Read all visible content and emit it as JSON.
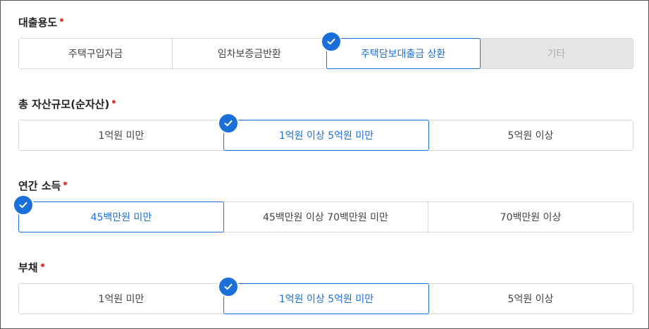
{
  "groups": [
    {
      "label": "대출용도",
      "required": true,
      "options": [
        "주택구입자금",
        "임차보증금반환",
        "주택담보대출금 상환",
        "기타"
      ],
      "selected": "주택담보대출금 상환",
      "disabled": [
        "기타"
      ]
    },
    {
      "label": "총 자산규모(순자산)",
      "required": true,
      "options": [
        "1억원 미만",
        "1억원 이상 5억원 미만",
        "5억원 이상"
      ],
      "selected": "1억원 이상 5억원 미만",
      "disabled": []
    },
    {
      "label": "연간 소득",
      "required": true,
      "options": [
        "45백만원 미만",
        "45백만원 이상 70백만원 미만",
        "70백만원 이상"
      ],
      "selected": "45백만원 미만",
      "disabled": []
    },
    {
      "label": "부채",
      "required": true,
      "options": [
        "1억원 미만",
        "1억원 이상 5억원 미만",
        "5억원 이상"
      ],
      "selected": "1억원 이상 5억원 미만",
      "disabled": []
    }
  ],
  "colors": {
    "accent": "#1a6fd8",
    "required_dot": "#e53935",
    "disabled_bg": "#e6e6e6",
    "border": "#d9d9d9"
  },
  "icons": {
    "selected": "check-circle-icon",
    "required": "required-dot-icon"
  }
}
